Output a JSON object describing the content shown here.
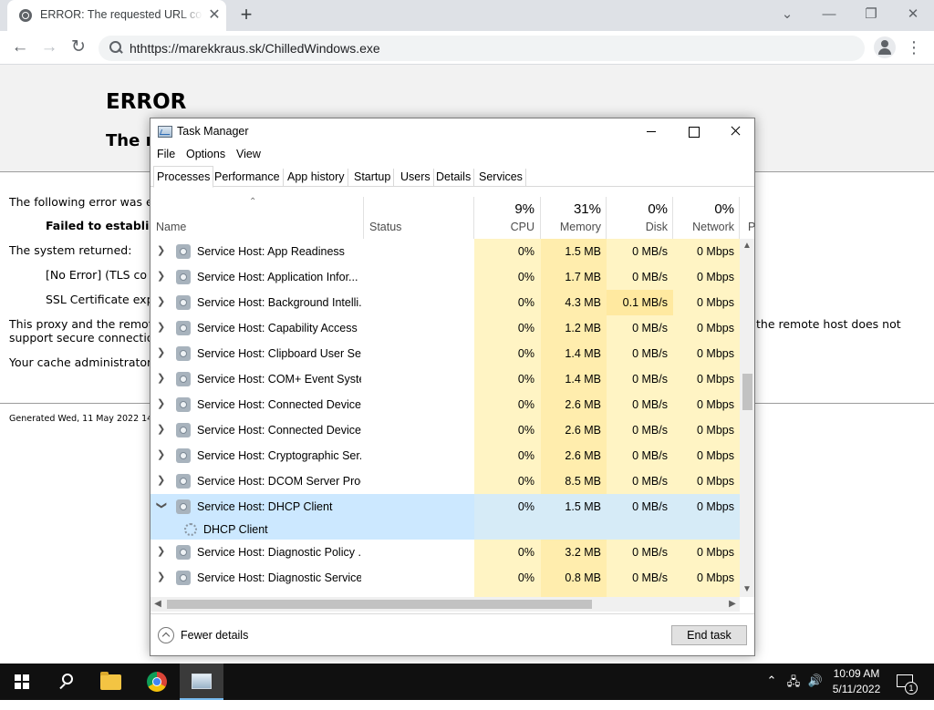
{
  "browser": {
    "tab_title": "ERROR: The requested URL could not be retrieved",
    "url": "hthttps://marekkraus.sk/ChilledWindows.exe"
  },
  "page": {
    "heading": "ERROR",
    "subheading": "The r",
    "line1": "The following error was e",
    "line2": "Failed to establis",
    "line3": "The system returned:",
    "line4": "[No Error] (TLS co",
    "line5": "SSL Certificate exp",
    "line6a": "This proxy and the remot",
    "line6b": "support secure connectio",
    "line6c": "the remote host does not",
    "line7": "Your cache administrator",
    "footer": "Generated Wed, 11 May 2022 14:"
  },
  "task_manager": {
    "title": "Task Manager",
    "menus": [
      "File",
      "Options",
      "View"
    ],
    "tabs": [
      "Processes",
      "Performance",
      "App history",
      "Startup",
      "Users",
      "Details",
      "Services"
    ],
    "columns": {
      "name": "Name",
      "status": "Status",
      "cpu_pct": "9%",
      "cpu": "CPU",
      "mem_pct": "31%",
      "mem": "Memory",
      "disk_pct": "0%",
      "disk": "Disk",
      "net_pct": "0%",
      "net": "Network",
      "power": "P"
    },
    "rows": [
      {
        "name": "Service Host: App Readiness",
        "cpu": "0%",
        "mem": "1.5 MB",
        "disk": "0 MB/s",
        "net": "0 Mbps"
      },
      {
        "name": "Service Host: Application Infor...",
        "cpu": "0%",
        "mem": "1.7 MB",
        "disk": "0 MB/s",
        "net": "0 Mbps"
      },
      {
        "name": "Service Host: Background Intelli...",
        "cpu": "0%",
        "mem": "4.3 MB",
        "disk": "0.1 MB/s",
        "net": "0 Mbps"
      },
      {
        "name": "Service Host: Capability Access ...",
        "cpu": "0%",
        "mem": "1.2 MB",
        "disk": "0 MB/s",
        "net": "0 Mbps"
      },
      {
        "name": "Service Host: Clipboard User Ser...",
        "cpu": "0%",
        "mem": "1.4 MB",
        "disk": "0 MB/s",
        "net": "0 Mbps"
      },
      {
        "name": "Service Host: COM+ Event Syste...",
        "cpu": "0%",
        "mem": "1.4 MB",
        "disk": "0 MB/s",
        "net": "0 Mbps"
      },
      {
        "name": "Service Host: Connected Device...",
        "cpu": "0%",
        "mem": "2.6 MB",
        "disk": "0 MB/s",
        "net": "0 Mbps"
      },
      {
        "name": "Service Host: Connected Device...",
        "cpu": "0%",
        "mem": "2.6 MB",
        "disk": "0 MB/s",
        "net": "0 Mbps"
      },
      {
        "name": "Service Host: Cryptographic Ser...",
        "cpu": "0%",
        "mem": "2.6 MB",
        "disk": "0 MB/s",
        "net": "0 Mbps"
      },
      {
        "name": "Service Host: DCOM Server Proc...",
        "cpu": "0%",
        "mem": "8.5 MB",
        "disk": "0 MB/s",
        "net": "0 Mbps"
      },
      {
        "name": "Service Host: DHCP Client",
        "cpu": "0%",
        "mem": "1.5 MB",
        "disk": "0 MB/s",
        "net": "0 Mbps"
      },
      {
        "name": "Service Host: Diagnostic Policy ...",
        "cpu": "0%",
        "mem": "3.2 MB",
        "disk": "0 MB/s",
        "net": "0 Mbps"
      },
      {
        "name": "Service Host: Diagnostic Service...",
        "cpu": "0%",
        "mem": "0.8 MB",
        "disk": "0 MB/s",
        "net": "0 Mbps"
      }
    ],
    "child_name": "DHCP Client",
    "fewer_details": "Fewer details",
    "end_task": "End task"
  },
  "taskbar": {
    "time": "10:09 AM",
    "date": "5/11/2022",
    "notification_count": "1"
  }
}
